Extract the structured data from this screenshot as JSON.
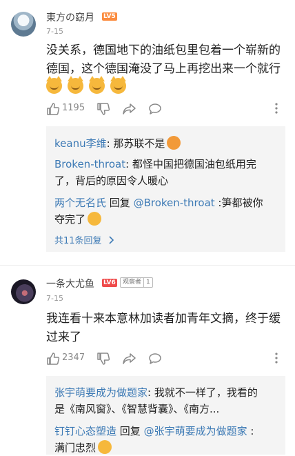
{
  "comments": [
    {
      "username": "東方の窈月",
      "level": "LV5",
      "date": "7-15",
      "content_lines": [
        "没关系，德国地下的油纸包里包着一个崭新的",
        "德国，这个德国淹没了马上再挖出来一个就行"
      ],
      "emoji_count": 4,
      "likes": "1195",
      "replies": [
        {
          "user": "keanu李维",
          "sep": ": ",
          "text": "那苏联不是",
          "emoji": "smirk-emoji"
        },
        {
          "user": "Broken-throat",
          "sep": ": ",
          "text_line1": "都怪中国把德国油包纸用完",
          "text_line2": "了，背后的原因令人暖心"
        },
        {
          "user": "两个无名氏",
          "middle": " 回复 ",
          "target": "@Broken-throat",
          "text_line1": " :笋都被你",
          "text_line2": "夺完了",
          "emoji": "doge-rose-emoji"
        }
      ],
      "expand_label": "共11条回复"
    },
    {
      "username": "一条大尤鱼",
      "level": "LV6",
      "badge_label": "观察者",
      "badge_num": "1",
      "date": "7-15",
      "content_lines": [
        "我连看十来本意林加读者加青年文摘，终于缓",
        "过来了"
      ],
      "likes": "2347",
      "replies": [
        {
          "user": "张宇萌要成为做题家",
          "sep": ": ",
          "text_line1": "我就不一样了，我看的",
          "text_line2": "是《南风窗》、《智慧背囊》、《南方..."
        },
        {
          "user": "钉钉心态塑造",
          "middle": " 回复 ",
          "target": "@张宇萌要成为做题家",
          "text_line1": " :",
          "text_line2": "满门忠烈",
          "emoji": "doge-emoji"
        }
      ]
    }
  ],
  "colors": {
    "link": "#3d7ab5",
    "lv5": "#fb8c3f",
    "lv6": "#ef4b4b",
    "reply_bg": "#f4f4f4"
  }
}
